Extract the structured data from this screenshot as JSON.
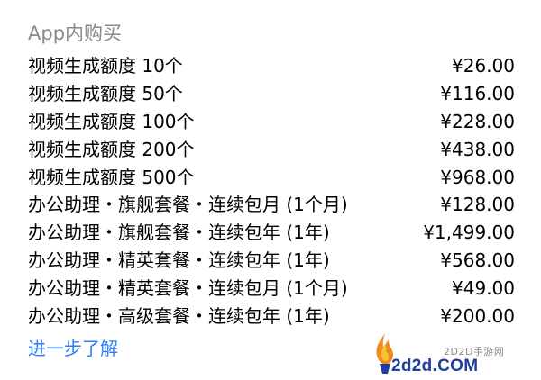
{
  "section": {
    "title": "App内购买"
  },
  "purchases": [
    {
      "name": "视频生成额度 10个",
      "price": "¥26.00"
    },
    {
      "name": "视频生成额度 50个",
      "price": "¥116.00"
    },
    {
      "name": "视频生成额度 100个",
      "price": "¥228.00"
    },
    {
      "name": "视频生成额度 200个",
      "price": "¥438.00"
    },
    {
      "name": "视频生成额度 500个",
      "price": "¥968.00"
    },
    {
      "name": "办公助理・旗舰套餐・连续包月 (1个月)",
      "price": "¥128.00"
    },
    {
      "name": "办公助理・旗舰套餐・连续包年 (1年)",
      "price": "¥1,499.00"
    },
    {
      "name": "办公助理・精英套餐・连续包年 (1年)",
      "price": "¥568.00"
    },
    {
      "name": "办公助理・精英套餐・连续包月 (1个月)",
      "price": "¥49.00"
    },
    {
      "name": "办公助理・高级套餐・连续包年 (1年)",
      "price": "¥200.00"
    }
  ],
  "learn_more": {
    "label": "进一步了解"
  },
  "watermark": {
    "site_name": "2D2D手游网",
    "domain": "2d2d.COM"
  },
  "colors": {
    "link": "#2f7cf6",
    "secondary_text": "#8a8a8e",
    "watermark_blue": "#1e3f9e",
    "flame_orange": "#f08a1c"
  }
}
